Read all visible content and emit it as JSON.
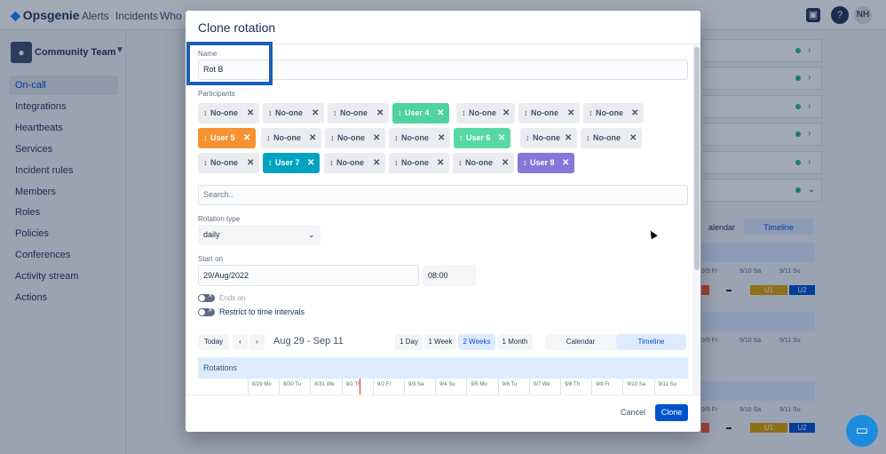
{
  "app": {
    "logo": "Opsgenie",
    "nav": [
      "Alerts",
      "Incidents",
      "Who is"
    ],
    "avatar_initials": "NH"
  },
  "sidebar": {
    "team_name": "Community Team",
    "items": [
      "On-call",
      "Integrations",
      "Heartbeats",
      "Services",
      "Incident rules",
      "Members",
      "Roles",
      "Policies",
      "Conferences",
      "Activity stream",
      "Actions"
    ],
    "active_item": "On-call"
  },
  "background": {
    "calendar_tab": "alendar",
    "timeline_tab": "Timeline",
    "day_labels_a": [
      "9/9 Fr",
      "9/10 Sa",
      "9/11 Su"
    ],
    "day_labels_b": [
      "9/9 Fr",
      "9/10 Sa",
      "9/11 Su"
    ],
    "day_labels_c": [
      "9/9 Fr",
      "9/10 Sa",
      "9/11 Su"
    ],
    "chips": [
      "U1",
      "U2",
      "U1",
      "U2"
    ]
  },
  "modal": {
    "title": "Clone rotation",
    "name_label": "Name",
    "name_value": "Rot B",
    "participants_label": "Participants",
    "participants": [
      {
        "name": "No-one",
        "color": null
      },
      {
        "name": "No-one",
        "color": null
      },
      {
        "name": "No-one",
        "color": null
      },
      {
        "name": "User 4",
        "color": "#4fd1a0"
      },
      {
        "name": "No-one",
        "color": null
      },
      {
        "name": "No-one",
        "color": null
      },
      {
        "name": "No-one",
        "color": null
      },
      {
        "name": "User 5",
        "color": "#f79232"
      },
      {
        "name": "No-one",
        "color": null
      },
      {
        "name": "No-one",
        "color": null
      },
      {
        "name": "No-one",
        "color": null
      },
      {
        "name": "User 6",
        "color": "#57d9a3"
      },
      {
        "name": "No-one",
        "color": null
      },
      {
        "name": "No-one",
        "color": null
      },
      {
        "name": "No-one",
        "color": null
      },
      {
        "name": "User 7",
        "color": "#00a3bf"
      },
      {
        "name": "No-one",
        "color": null
      },
      {
        "name": "No-one",
        "color": null
      },
      {
        "name": "No-one",
        "color": null
      },
      {
        "name": "User 8",
        "color": "#8777d9"
      }
    ],
    "search_placeholder": "Search..",
    "rotation_type_label": "Rotation type",
    "rotation_type_value": "daily",
    "start_on_label": "Start on",
    "start_date": "29/Aug/2022",
    "start_time": "08:00",
    "ends_on_label": "Ends on",
    "restrict_label": "Restrict to time intervals",
    "today_button": "Today",
    "range_label": "Aug 29 - Sep 11",
    "range_buttons": [
      "1 Day",
      "1 Week",
      "2 Weeks",
      "1 Month"
    ],
    "range_selected": "2 Weeks",
    "view_buttons": [
      "Calendar",
      "Timeline"
    ],
    "view_selected": "Timeline",
    "rotations_label": "Rotations",
    "timeline_days": [
      "8/29 Mo",
      "8/30 Tu",
      "8/31 We",
      "9/1 Th",
      "9/2 Fr",
      "9/3 Sa",
      "9/4 Su",
      "9/5 Mo",
      "9/6 Tu",
      "9/7 We",
      "9/8 Th",
      "9/9 Fr",
      "9/10 Sa",
      "9/11 Su"
    ],
    "cancel_button": "Cancel",
    "clone_button": "Clone"
  },
  "colors": {
    "primary": "#0052cc",
    "highlight_box": "#1d5eb6",
    "overlay": "rgba(9,30,66,0.38)"
  }
}
